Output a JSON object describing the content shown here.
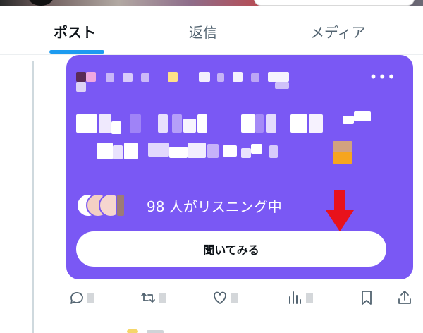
{
  "tabs": [
    {
      "label": "ポスト",
      "active": true
    },
    {
      "label": "返信",
      "active": false
    },
    {
      "label": "メディア",
      "active": false
    }
  ],
  "colors": {
    "card_bg": "#7a58f4",
    "tab_indicator": "#1d9bf0",
    "arrow": "#e8121b",
    "icon_gray": "#536471"
  },
  "space_card": {
    "more_label": "•••",
    "listener_text": "98 人がリスニング中",
    "listen_button": "聞いてみる"
  },
  "actions": {
    "icons": [
      "reply-icon",
      "repost-icon",
      "like-icon",
      "views-icon",
      "bookmark-icon",
      "share-icon"
    ]
  }
}
